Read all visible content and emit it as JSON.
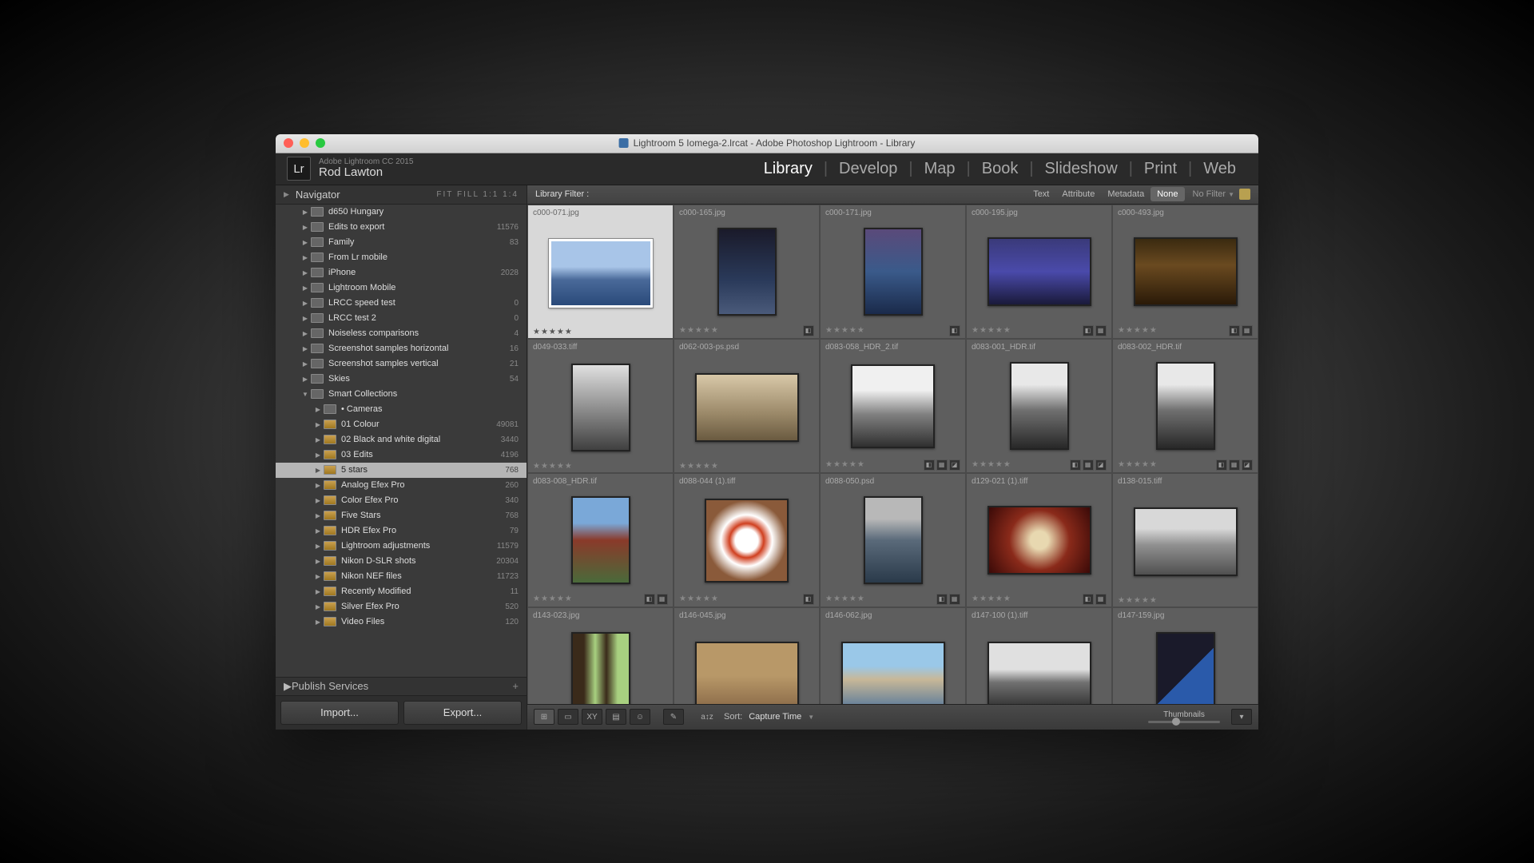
{
  "titlebar": {
    "text": "Lightroom 5 Iomega-2.lrcat - Adobe Photoshop Lightroom - Library"
  },
  "header": {
    "logo": "Lr",
    "product": "Adobe Lightroom CC 2015",
    "user": "Rod Lawton",
    "modules": [
      "Library",
      "Develop",
      "Map",
      "Book",
      "Slideshow",
      "Print",
      "Web"
    ],
    "active_module": "Library"
  },
  "navigator": {
    "title": "Navigator",
    "zoom": "FIT   FILL   1:1   1:4"
  },
  "tree": [
    {
      "indent": 1,
      "label": "d650 Hungary",
      "count": "",
      "smart": false,
      "tri": "▶"
    },
    {
      "indent": 1,
      "label": "Edits to export",
      "count": "11576",
      "smart": false,
      "tri": "▶"
    },
    {
      "indent": 1,
      "label": "Family",
      "count": "83",
      "smart": false,
      "tri": "▶"
    },
    {
      "indent": 1,
      "label": "From Lr mobile",
      "count": "",
      "smart": false,
      "tri": "▶"
    },
    {
      "indent": 1,
      "label": "iPhone",
      "count": "2028",
      "smart": false,
      "tri": "▶"
    },
    {
      "indent": 1,
      "label": "Lightroom Mobile",
      "count": "",
      "smart": false,
      "tri": "▶"
    },
    {
      "indent": 1,
      "label": "LRCC speed test",
      "count": "0",
      "smart": false,
      "tri": "▶"
    },
    {
      "indent": 1,
      "label": "LRCC test 2",
      "count": "0",
      "smart": false,
      "tri": "▶"
    },
    {
      "indent": 1,
      "label": "Noiseless comparisons",
      "count": "4",
      "smart": false,
      "tri": "▶"
    },
    {
      "indent": 1,
      "label": "Screenshot samples horizontal",
      "count": "16",
      "smart": false,
      "tri": "▶"
    },
    {
      "indent": 1,
      "label": "Screenshot samples vertical",
      "count": "21",
      "smart": false,
      "tri": "▶"
    },
    {
      "indent": 1,
      "label": "Skies",
      "count": "54",
      "smart": false,
      "tri": "▶"
    },
    {
      "indent": 1,
      "label": "Smart Collections",
      "count": "",
      "smart": false,
      "tri": "▼"
    },
    {
      "indent": 2,
      "label": "• Cameras",
      "count": "",
      "smart": false,
      "tri": "▶"
    },
    {
      "indent": 2,
      "label": "01 Colour",
      "count": "49081",
      "smart": true,
      "tri": "▶"
    },
    {
      "indent": 2,
      "label": "02 Black and white digital",
      "count": "3440",
      "smart": true,
      "tri": "▶"
    },
    {
      "indent": 2,
      "label": "03 Edits",
      "count": "4196",
      "smart": true,
      "tri": "▶"
    },
    {
      "indent": 2,
      "label": "5 stars",
      "count": "768",
      "smart": true,
      "tri": "▶",
      "selected": true
    },
    {
      "indent": 2,
      "label": "Analog Efex Pro",
      "count": "260",
      "smart": true,
      "tri": "▶"
    },
    {
      "indent": 2,
      "label": "Color Efex Pro",
      "count": "340",
      "smart": true,
      "tri": "▶"
    },
    {
      "indent": 2,
      "label": "Five Stars",
      "count": "768",
      "smart": true,
      "tri": "▶"
    },
    {
      "indent": 2,
      "label": "HDR Efex Pro",
      "count": "79",
      "smart": true,
      "tri": "▶"
    },
    {
      "indent": 2,
      "label": "Lightroom adjustments",
      "count": "11579",
      "smart": true,
      "tri": "▶"
    },
    {
      "indent": 2,
      "label": "Nikon D-SLR shots",
      "count": "20304",
      "smart": true,
      "tri": "▶"
    },
    {
      "indent": 2,
      "label": "Nikon NEF files",
      "count": "11723",
      "smart": true,
      "tri": "▶"
    },
    {
      "indent": 2,
      "label": "Recently Modified",
      "count": "11",
      "smart": true,
      "tri": "▶"
    },
    {
      "indent": 2,
      "label": "Silver Efex Pro",
      "count": "520",
      "smart": true,
      "tri": "▶"
    },
    {
      "indent": 2,
      "label": "Video Files",
      "count": "120",
      "smart": true,
      "tri": "▶"
    }
  ],
  "publish": {
    "title": "Publish Services"
  },
  "buttons": {
    "import": "Import...",
    "export": "Export..."
  },
  "filter": {
    "label": "Library Filter :",
    "items": [
      "Text",
      "Attribute",
      "Metadata",
      "None"
    ],
    "active": "None",
    "nofilter": "No Filter"
  },
  "stars": "★★★★★",
  "thumbs": [
    {
      "fname": "c000-071.jpg",
      "klass": "th-sea",
      "shape": "tw",
      "selected": true,
      "badges": []
    },
    {
      "fname": "c000-165.jpg",
      "klass": "th-moon",
      "shape": "tp",
      "badges": [
        "◧"
      ]
    },
    {
      "fname": "c000-171.jpg",
      "klass": "th-harbour",
      "shape": "tp",
      "badges": [
        "◧"
      ]
    },
    {
      "fname": "c000-195.jpg",
      "klass": "th-pier",
      "shape": "tw",
      "badges": [
        "◧",
        "▦"
      ]
    },
    {
      "fname": "c000-493.jpg",
      "klass": "th-street",
      "shape": "tw",
      "badges": [
        "◧",
        "▦"
      ]
    },
    {
      "fname": "d049-033.tiff",
      "klass": "th-girl",
      "shape": "tp",
      "badges": []
    },
    {
      "fname": "d062-003-ps.psd",
      "klass": "th-track",
      "shape": "tw",
      "badges": []
    },
    {
      "fname": "d083-058_HDR_2.tif",
      "klass": "th-fence",
      "shape": "ts",
      "badges": [
        "◧",
        "▦",
        "◪"
      ]
    },
    {
      "fname": "d083-001_HDR.tif",
      "klass": "th-fence2",
      "shape": "tp",
      "badges": [
        "◧",
        "▦",
        "◪"
      ]
    },
    {
      "fname": "d083-002_HDR.tif",
      "klass": "th-fence2",
      "shape": "tp",
      "badges": [
        "◧",
        "▦",
        "◪"
      ]
    },
    {
      "fname": "d083-008_HDR.tif",
      "klass": "th-barn",
      "shape": "tp",
      "badges": [
        "◧",
        "▦"
      ]
    },
    {
      "fname": "d088-044 (1).tiff",
      "klass": "th-life",
      "shape": "ts",
      "badges": [
        "◧"
      ]
    },
    {
      "fname": "d088-050.psd",
      "klass": "th-marina",
      "shape": "tp",
      "badges": [
        "◧",
        "▦"
      ]
    },
    {
      "fname": "d129-021 (1).tiff",
      "klass": "th-watch",
      "shape": "tw",
      "badges": [
        "◧",
        "▦"
      ]
    },
    {
      "fname": "d138-015.tiff",
      "klass": "th-river",
      "shape": "tw",
      "badges": []
    },
    {
      "fname": "d143-023.jpg",
      "klass": "th-window",
      "shape": "tp",
      "badges": []
    },
    {
      "fname": "d146-045.jpg",
      "klass": "th-wall",
      "shape": "tw",
      "badges": []
    },
    {
      "fname": "d146-062.jpg",
      "klass": "th-town",
      "shape": "tw",
      "badges": []
    },
    {
      "fname": "d147-100 (1).tiff",
      "klass": "th-bw",
      "shape": "tw",
      "badges": []
    },
    {
      "fname": "d147-159.jpg",
      "klass": "th-blue",
      "shape": "tp",
      "badges": []
    }
  ],
  "toolbar": {
    "sort_label": "Sort:",
    "sort_value": "Capture Time",
    "thumb_label": "Thumbnails"
  }
}
